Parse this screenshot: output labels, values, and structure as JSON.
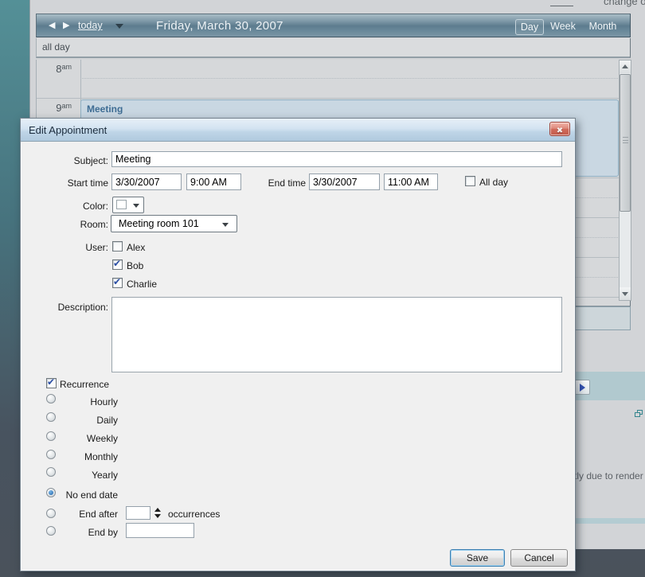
{
  "desktop": {
    "top_cut_text": "change o",
    "note_text": "tly due to render"
  },
  "icons": {
    "close": "✖",
    "check": "✔",
    "prev": "◀",
    "next": "▶"
  },
  "calendar": {
    "today_label": "today",
    "title": "Friday, March 30, 2007",
    "views": [
      {
        "label": "Day",
        "active": true
      },
      {
        "label": "Week",
        "active": false
      },
      {
        "label": "Month",
        "active": false
      }
    ],
    "all_day_label": "all day",
    "hours": [
      {
        "num": "8",
        "suffix": "am"
      },
      {
        "num": "9",
        "suffix": "am"
      }
    ],
    "event_title": "Meeting"
  },
  "dialog": {
    "title": "Edit Appointment",
    "subject": {
      "label": "Subject:",
      "value": "Meeting"
    },
    "start": {
      "label": "Start time",
      "date": "3/30/2007",
      "time": "9:00 AM"
    },
    "end": {
      "label": "End time",
      "date": "3/30/2007",
      "time": "11:00 AM"
    },
    "all_day": {
      "label": "All day",
      "checked": false
    },
    "color": {
      "label": "Color:"
    },
    "room": {
      "label": "Room:",
      "value": "Meeting room 101"
    },
    "user": {
      "label": "User:",
      "options": [
        {
          "label": "Alex",
          "checked": false
        },
        {
          "label": "Bob",
          "checked": true
        },
        {
          "label": "Charlie",
          "checked": true
        }
      ]
    },
    "description": {
      "label": "Description:",
      "value": ""
    },
    "recurrence": {
      "label": "Recurrence",
      "checked": true
    },
    "frequencies": [
      {
        "label": "Hourly",
        "selected": false
      },
      {
        "label": "Daily",
        "selected": false
      },
      {
        "label": "Weekly",
        "selected": false
      },
      {
        "label": "Monthly",
        "selected": false
      },
      {
        "label": "Yearly",
        "selected": false
      }
    ],
    "ending": {
      "no_end": {
        "label": "No end date",
        "selected": true
      },
      "end_after": {
        "label": "End after",
        "selected": false,
        "value": "",
        "suffix": "occurrences"
      },
      "end_by": {
        "label": "End by",
        "selected": false,
        "value": ""
      }
    },
    "save_label": "Save",
    "cancel_label": "Cancel"
  }
}
